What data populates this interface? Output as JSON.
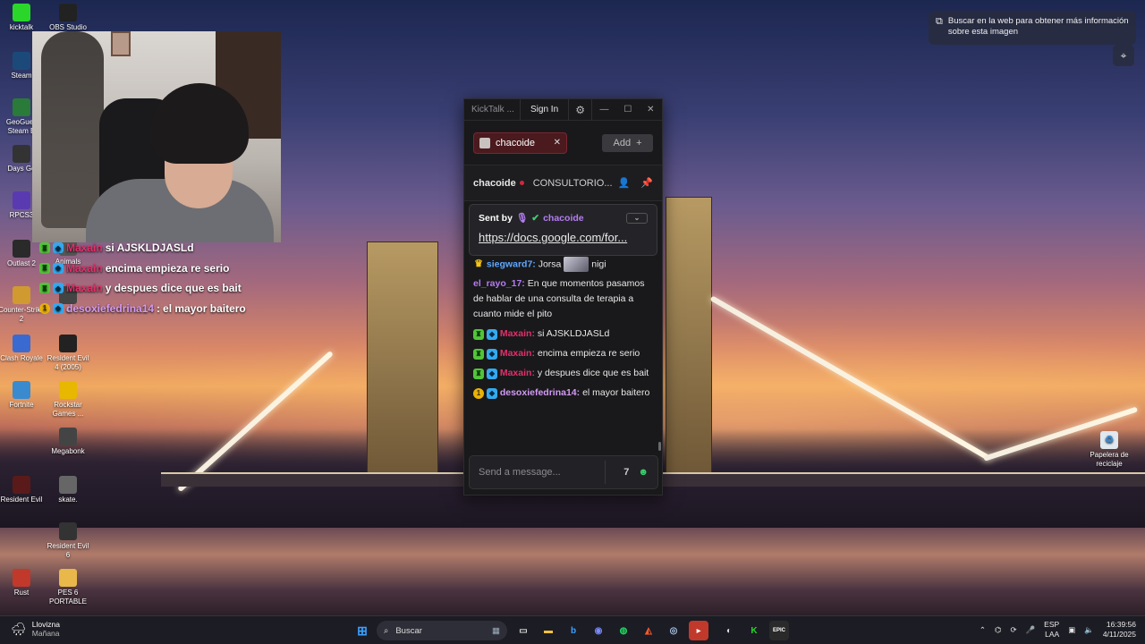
{
  "desktop": {
    "icons_col1": [
      {
        "label": "kicktalk",
        "icon": "kick-icon",
        "color": "#2bd62b"
      },
      {
        "label": "Steam",
        "icon": "steam-icon",
        "color": "#1b4a7a"
      },
      {
        "label": "GeoGues Steam E",
        "icon": "geoguessr-icon",
        "color": "#2a7a3a"
      },
      {
        "label": "Days Go",
        "icon": "game-icon",
        "color": "#333"
      },
      {
        "label": "RPCS3",
        "icon": "rpcs3-icon",
        "color": "#5a3ab0"
      },
      {
        "label": "Outlast 2",
        "icon": "game-icon",
        "color": "#2a2a2a"
      },
      {
        "label": "Counter-Strike 2",
        "icon": "cs2-icon",
        "color": "#d09a30"
      },
      {
        "label": "Clash Royale",
        "icon": "clash-icon",
        "color": "#3a6ad0"
      },
      {
        "label": "Fortnite",
        "icon": "fortnite-icon",
        "color": "#3a8ad0"
      },
      {
        "label": "Resident Evil",
        "icon": "game-icon",
        "color": "#5a1a1a"
      },
      {
        "label": "Rust",
        "icon": "rust-icon",
        "color": "#c0392b"
      }
    ],
    "icons_col2": [
      {
        "label": "OBS Studio",
        "icon": "obs-icon",
        "color": "#222"
      },
      {
        "label": "Animals",
        "icon": "game-icon",
        "color": "#555"
      },
      {
        "label": "4",
        "icon": "game-icon",
        "color": "#444"
      },
      {
        "label": "Resident Evil 4 (2005)",
        "icon": "game-icon",
        "color": "#222"
      },
      {
        "label": "Rockstar Games ...",
        "icon": "rockstar-icon",
        "color": "#e8b800"
      },
      {
        "label": "Megabonk",
        "icon": "game-icon",
        "color": "#444"
      },
      {
        "label": "skate.",
        "icon": "skate-icon",
        "color": "#666"
      },
      {
        "label": "Resident Evil 6",
        "icon": "game-icon",
        "color": "#333"
      },
      {
        "label": "PES 6 PORTABLE",
        "icon": "folder-icon",
        "color": "#e8b84a"
      }
    ],
    "recycle_bin": "Papelera de reciclaje"
  },
  "overlay_chat": [
    {
      "user": "Maxain",
      "text": "si AJSKLDJASLd",
      "badges": [
        "sub",
        "gift"
      ]
    },
    {
      "user": "Maxain",
      "text": "encima empieza re serio",
      "badges": [
        "sub",
        "gift"
      ]
    },
    {
      "user": "Maxain",
      "text": "y despues dice que es bait",
      "badges": [
        "sub",
        "gift"
      ]
    },
    {
      "user": "desoxiefedrina14",
      "text": "el mayor baitero",
      "badges": [
        "one",
        "gift"
      ]
    }
  ],
  "kicktalk": {
    "app_title": "KickTalk ...",
    "sign_in": "Sign In",
    "tab_channel": "chacoide",
    "add_label": "Add",
    "channel_name": "chacoide",
    "stream_title": "CONSULTORIO...",
    "pinned": {
      "sent_by": "Sent by",
      "user": "chacoide",
      "link": "https://docs.google.com/for..."
    },
    "messages": [
      {
        "user": "siegward7:",
        "user_color": "#5fa8ff",
        "text": "Jorsa",
        "text2": "nigi",
        "badge": "crown",
        "emote": true
      },
      {
        "user": "el_rayo_17:",
        "user_color": "#b47cf2",
        "text": "En que momentos pasamos de hablar de una consulta de terapia a cuanto mide el pito"
      },
      {
        "user": "Maxain:",
        "user_color": "#e0306a",
        "text": "si AJSKLDJASLd",
        "badge": "subgift"
      },
      {
        "user": "Maxain:",
        "user_color": "#e0306a",
        "text": "encima empieza re serio",
        "badge": "subgift"
      },
      {
        "user": "Maxain:",
        "user_color": "#e0306a",
        "text": "y despues dice que es bait",
        "badge": "subgift"
      },
      {
        "user": "desoxiefedrina14:",
        "user_color": "#d39af6",
        "text": "el mayor baitero",
        "badge": "onegift"
      }
    ],
    "input_placeholder": "Send a message..."
  },
  "lens_popup": {
    "text": "Buscar en la web para obtener más información sobre esta imagen"
  },
  "taskbar": {
    "weather_title": "Llovizna",
    "weather_sub": "Mañana",
    "search_placeholder": "Buscar",
    "lang_top": "ESP",
    "lang_bottom": "LAA",
    "time": "16:39:56",
    "date": "4/11/2025"
  }
}
